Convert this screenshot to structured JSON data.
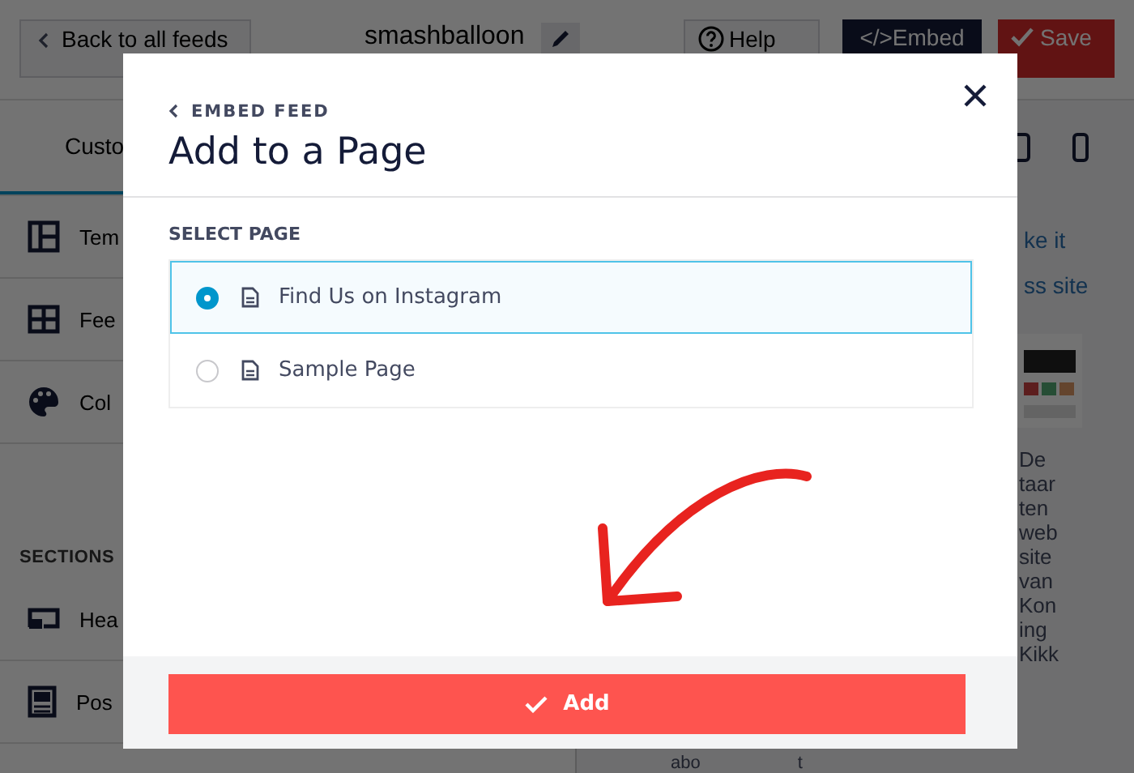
{
  "toolbar": {
    "back_button": "Back to all feeds",
    "feed_name": "smashballoon",
    "help_button": "Help",
    "embed_button": "</>Embed",
    "save_button": "Save"
  },
  "tabs": [
    {
      "label": "Custo",
      "selected": true
    }
  ],
  "sidebar": {
    "items": [
      {
        "label": "Tem",
        "kind": "layout"
      },
      {
        "label": "Fee",
        "kind": "grid"
      },
      {
        "label": "Col",
        "kind": "palette"
      }
    ],
    "section_heading": "SECTIONS",
    "section_items": [
      {
        "label": "Hea",
        "kind": "header"
      },
      {
        "label": "Pos",
        "kind": "post"
      }
    ]
  },
  "preview": {
    "links": [
      "ke it",
      "ss site"
    ],
    "column_text": [
      "De",
      "taar",
      "ten",
      "web",
      "site",
      "van",
      "Kon",
      "ing",
      "Kikk"
    ],
    "bottom_text": [
      "abo",
      "t"
    ]
  },
  "modal": {
    "back_link": "EMBED FEED",
    "title": "Add to a Page",
    "field_label": "SELECT PAGE",
    "pages": [
      {
        "label": "Find Us on Instagram",
        "selected": true
      },
      {
        "label": "Sample Page",
        "selected": false
      }
    ],
    "add_button": "Add"
  }
}
